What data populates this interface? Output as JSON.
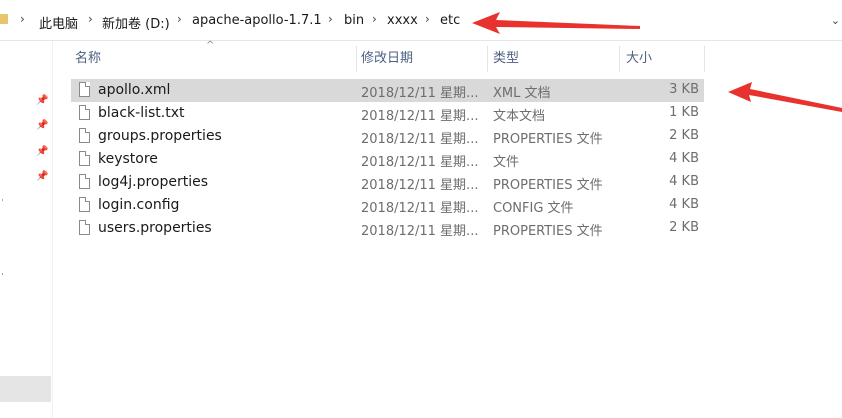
{
  "breadcrumb": {
    "items": [
      "此电脑",
      "新加卷 (D:)",
      "apache-apollo-1.7.1",
      "bin",
      "xxxx",
      "etc"
    ]
  },
  "columns": {
    "name": "名称",
    "date": "修改日期",
    "type": "类型",
    "size": "大小"
  },
  "files": [
    {
      "name": "apollo.xml",
      "date": "2018/12/11 星期...",
      "type": "XML 文档",
      "size": "3 KB",
      "selected": true
    },
    {
      "name": "black-list.txt",
      "date": "2018/12/11 星期...",
      "type": "文本文档",
      "size": "1 KB"
    },
    {
      "name": "groups.properties",
      "date": "2018/12/11 星期...",
      "type": "PROPERTIES 文件",
      "size": "2 KB"
    },
    {
      "name": "keystore",
      "date": "2018/12/11 星期...",
      "type": "文件",
      "size": "4 KB"
    },
    {
      "name": "log4j.properties",
      "date": "2018/12/11 星期...",
      "type": "PROPERTIES 文件",
      "size": "4 KB"
    },
    {
      "name": "login.config",
      "date": "2018/12/11 星期...",
      "type": "CONFIG 文件",
      "size": "4 KB"
    },
    {
      "name": "users.properties",
      "date": "2018/12/11 星期...",
      "type": "PROPERTIES 文件",
      "size": "2 KB"
    }
  ],
  "icons": {
    "folder": "folder-icon",
    "pin": "pin-icon",
    "file": "file-icon",
    "annotation": "red-arrow-annotation"
  },
  "colors": {
    "selected_row": "#d9d9d9",
    "header_text": "#4d6082",
    "annotation_arrow": "#e8322d"
  }
}
